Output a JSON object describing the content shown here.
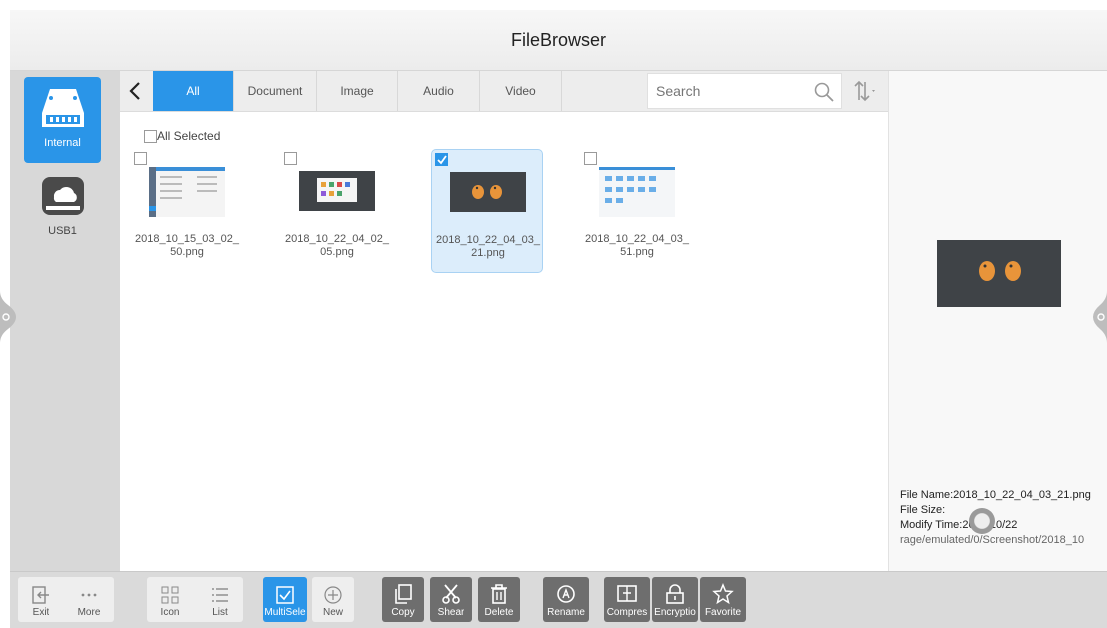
{
  "app": {
    "title": "FileBrowser"
  },
  "sidebar": {
    "drives": [
      {
        "label": "Internal",
        "active": true
      },
      {
        "label": "USB1",
        "active": false
      }
    ]
  },
  "tabs": [
    {
      "label": "All",
      "active": true
    },
    {
      "label": "Document",
      "active": false
    },
    {
      "label": "Image",
      "active": false
    },
    {
      "label": "Audio",
      "active": false
    },
    {
      "label": "Video",
      "active": false
    }
  ],
  "search": {
    "placeholder": "Search"
  },
  "content": {
    "all_selected_label": "All Selected",
    "files": [
      {
        "name_line1": "2018_10_15_03_02_",
        "name_line2": "50.png",
        "checked": false
      },
      {
        "name_line1": "2018_10_22_04_02_",
        "name_line2": "05.png",
        "checked": false
      },
      {
        "name_line1": "2018_10_22_04_03_",
        "name_line2": "21.png",
        "checked": true
      },
      {
        "name_line1": "2018_10_22_04_03_",
        "name_line2": "51.png",
        "checked": false
      }
    ]
  },
  "preview": {
    "file_name": "File Name:2018_10_22_04_03_21.png",
    "file_size": "File Size:",
    "modify_time": "Modify Time:2018/10/22",
    "path": "rage/emulated/0/Screenshot/2018_10"
  },
  "toolbar": {
    "exit": "Exit",
    "more": "More",
    "icon": "Icon",
    "list": "List",
    "multiselect": "MultiSele",
    "new": "New",
    "copy": "Copy",
    "shear": "Shear",
    "delete": "Delete",
    "rename": "Rename",
    "compress": "Compres",
    "encryption": "Encryptio",
    "favorite": "Favorite"
  },
  "colors": {
    "accent": "#2a95e8",
    "toolbar_dark": "#6e6e6e",
    "sidebar": "#d8d8d8"
  }
}
